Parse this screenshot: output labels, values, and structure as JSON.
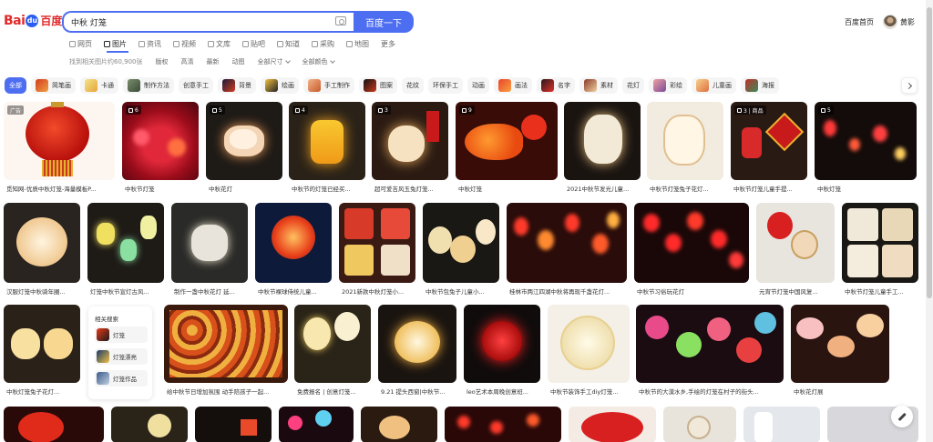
{
  "header": {
    "logo_text": "Bai",
    "logo_paw": "du",
    "logo_cn": "百度",
    "search_value": "中秋 灯笼",
    "search_button": "百度一下",
    "home_link": "百度首页",
    "username": "黄影"
  },
  "nav": {
    "tabs": [
      {
        "label": "网页",
        "icon": "web-icon"
      },
      {
        "label": "图片",
        "icon": "image-icon"
      },
      {
        "label": "资讯",
        "icon": "news-icon"
      },
      {
        "label": "视频",
        "icon": "video-icon"
      },
      {
        "label": "文库",
        "icon": "doc-icon"
      },
      {
        "label": "贴吧",
        "icon": "forum-icon"
      },
      {
        "label": "知道",
        "icon": "qa-icon"
      },
      {
        "label": "采购",
        "icon": "shop-icon"
      },
      {
        "label": "地图",
        "icon": "map-icon"
      },
      {
        "label": "更多",
        "icon": ""
      }
    ],
    "active": "图片"
  },
  "filters": {
    "result_count": "找到相关图片约60,900张",
    "items": [
      "版权",
      "高清",
      "最新",
      "动图"
    ],
    "size": "全部尺寸",
    "color": "全部颜色"
  },
  "chips": [
    "全部",
    "简笔画",
    "卡通",
    "制作方法",
    "创意手工",
    "背景",
    "绘画",
    "手工制作",
    "图案",
    "花纹",
    "环保手工",
    "动画",
    "画法",
    "名字",
    "素材",
    "花灯",
    "彩绘",
    "儿童画",
    "海报"
  ],
  "grid": {
    "row1": [
      {
        "caption": "觅知网-优质中秋灯笼-海量模板P...",
        "badge": "广告"
      },
      {
        "caption": "中秋节灯笼",
        "badge": "6"
      },
      {
        "caption": "中秋花灯",
        "badge": "5"
      },
      {
        "caption": "中秋节的灯笼已经买...",
        "badge": "4"
      },
      {
        "caption": "超可爱吉风玉兔灯笼...",
        "badge": "3"
      },
      {
        "caption": "中秋灯笼",
        "badge": "9"
      },
      {
        "caption": "2021中秋节发光儿童...",
        "badge": ""
      },
      {
        "caption": "中秋节灯笼兔子花灯...",
        "badge": ""
      },
      {
        "caption": "中秋节灯笼儿童手提...",
        "badge": "3 | 商品"
      },
      {
        "caption": "中秋灯笼",
        "badge": "5"
      }
    ],
    "row2": [
      "汉服灯笼中秋骑年圈...",
      "灯笼中秋节宣灯古风...",
      "制作一盏中秋花灯 延...",
      "中秋节裸球侍统儿童...",
      "2021新款中秋灯笼小...",
      "中秋节包兔子儿童小...",
      "桂林市两江四湖中秋将再现千盏花灯...",
      "中秋节习俗玩花灯",
      "元宵节灯笼中国风复...",
      "中秋节灯笼儿童手工..."
    ],
    "row3": [
      "中秋灯笼兔子花灯...",
      "给中秋节日增加氛围 动手陪孩子一起...",
      "免费报名 | 创意灯笼...",
      "9.21 提头西窗|中秋节...",
      "leo艺术本周晚创意班...",
      "中秋节装饰手工diy灯笼...",
      "中秋节的大漠水乡,手绘的灯笼在村子的街头...",
      "中秋花灯展"
    ],
    "related": {
      "title": "相关搜索",
      "items": [
        "灯笼",
        "灯笼漂亮",
        "灯笼作品"
      ]
    }
  },
  "colors": {
    "accent": "#4e6ef2",
    "brand_red": "#e02a2a"
  }
}
